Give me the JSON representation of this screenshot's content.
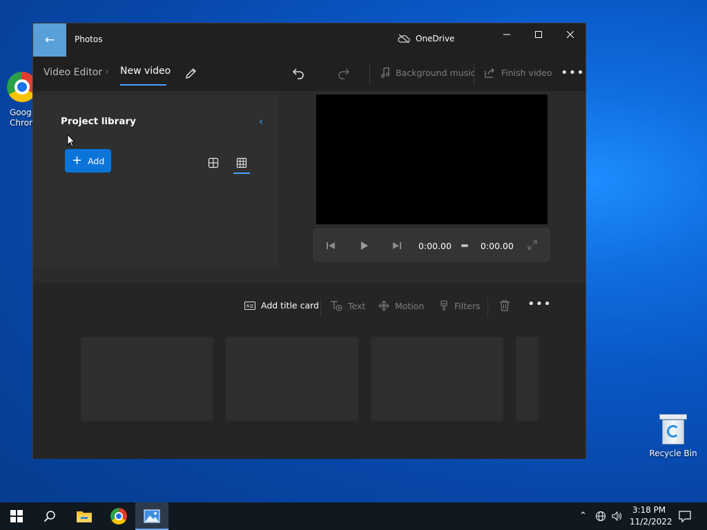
{
  "desktop": {
    "icons": [
      {
        "name": "google-chrome-shortcut",
        "label": "Goog Chron"
      },
      {
        "name": "recycle-bin",
        "label": "Recycle Bin"
      }
    ]
  },
  "window": {
    "app_title": "Photos",
    "onedrive_label": "OneDrive",
    "breadcrumb": {
      "home": "Video Editor",
      "current": "New video"
    },
    "toolbar": {
      "background_music": "Background music",
      "finish_video": "Finish video"
    },
    "project_library": {
      "title": "Project library",
      "add_label": "Add"
    },
    "player": {
      "current_time": "0:00.00",
      "total_time": "0:00.00"
    },
    "storyboard": {
      "add_title_card": "Add title card",
      "text": "Text",
      "motion": "Motion",
      "filters": "Filters"
    }
  },
  "taskbar": {
    "time": "3:18 PM",
    "date": "11/2/2022"
  },
  "colors": {
    "accent": "#0a74d9",
    "window_bg": "#2b2b2b",
    "titlebar_bg": "#202020",
    "desktop_blue": "#0a57c6"
  }
}
